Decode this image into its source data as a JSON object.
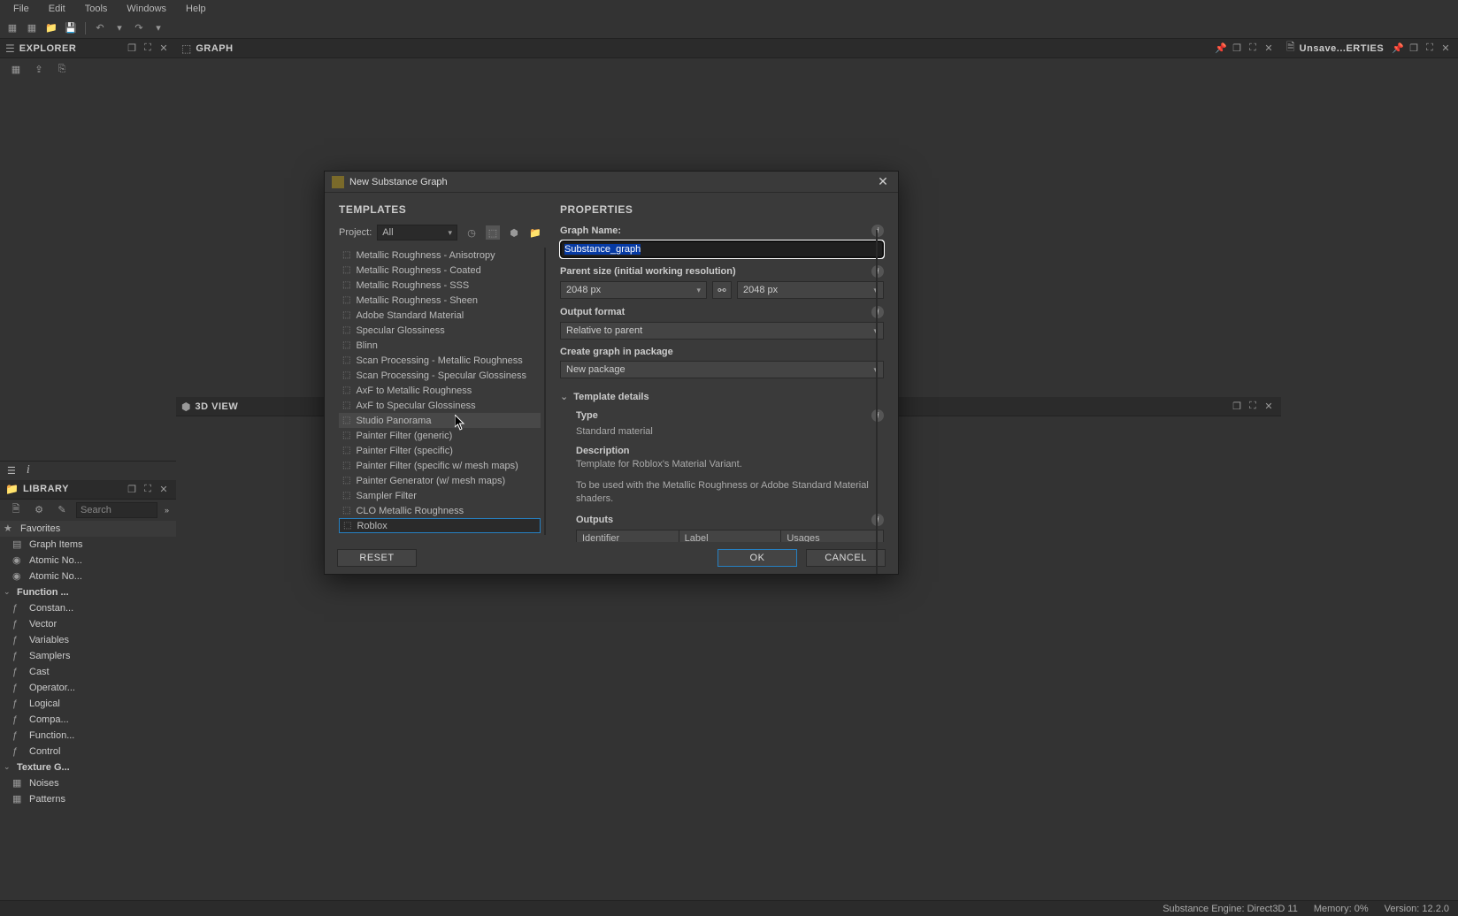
{
  "menu": {
    "items": [
      "File",
      "Edit",
      "Tools",
      "Windows",
      "Help"
    ]
  },
  "panels": {
    "explorer": "EXPLORER",
    "library": "LIBRARY",
    "graph": "GRAPH",
    "view3d": "3D VIEW",
    "properties": "Unsave...ERTIES"
  },
  "search_placeholder": "Search",
  "library_tree": {
    "favorites": "Favorites",
    "items1": [
      "Graph Items",
      "Atomic No...",
      "Atomic No..."
    ],
    "fn_header": "Function ...",
    "fn_items": [
      "Constan...",
      "Vector",
      "Variables",
      "Samplers",
      "Cast",
      "Operator...",
      "Logical",
      "Compa...",
      "Function...",
      "Control"
    ],
    "tex_header": "Texture G...",
    "tex_items": [
      "Noises",
      "Patterns"
    ]
  },
  "dialog": {
    "title": "New Substance Graph",
    "templates_title": "TEMPLATES",
    "properties_title": "PROPERTIES",
    "project_label": "Project:",
    "project_value": "All",
    "templates": [
      "Metallic Roughness - Anisotropy",
      "Metallic Roughness - Coated",
      "Metallic Roughness - SSS",
      "Metallic Roughness - Sheen",
      "Adobe Standard Material",
      "Specular Glossiness",
      "Blinn",
      "Scan Processing - Metallic Roughness",
      "Scan Processing - Specular Glossiness",
      "AxF to Metallic Roughness",
      "AxF to Specular Glossiness",
      "Studio Panorama",
      "Painter Filter (generic)",
      "Painter Filter (specific)",
      "Painter Filter (specific w/ mesh maps)",
      "Painter Generator (w/ mesh maps)",
      "Sampler Filter",
      "CLO Metallic Roughness",
      "Roblox"
    ],
    "hovered_index": 11,
    "selected_index": 18,
    "graph_name_label": "Graph Name:",
    "graph_name_value": "Substance_graph",
    "parent_size_label": "Parent size (initial working resolution)",
    "size_width": "2048 px",
    "size_height": "2048 px",
    "output_format_label": "Output format",
    "output_format_value": "Relative to parent",
    "create_in_label": "Create graph in package",
    "create_in_value": "New package",
    "template_details": "Template details",
    "type_label": "Type",
    "type_value": "Standard material",
    "desc_label": "Description",
    "desc_1": "Template for Roblox's Material Variant.",
    "desc_2": "To be used with the Metallic Roughness or Adobe Standard Material shaders.",
    "outputs_label": "Outputs",
    "outputs_cols": [
      "Identifier",
      "Label",
      "Usages"
    ],
    "reset": "RESET",
    "ok": "OK",
    "cancel": "CANCEL"
  },
  "status": {
    "engine": "Substance Engine: Direct3D 11",
    "memory": "Memory: 0%",
    "version": "Version: 12.2.0"
  }
}
